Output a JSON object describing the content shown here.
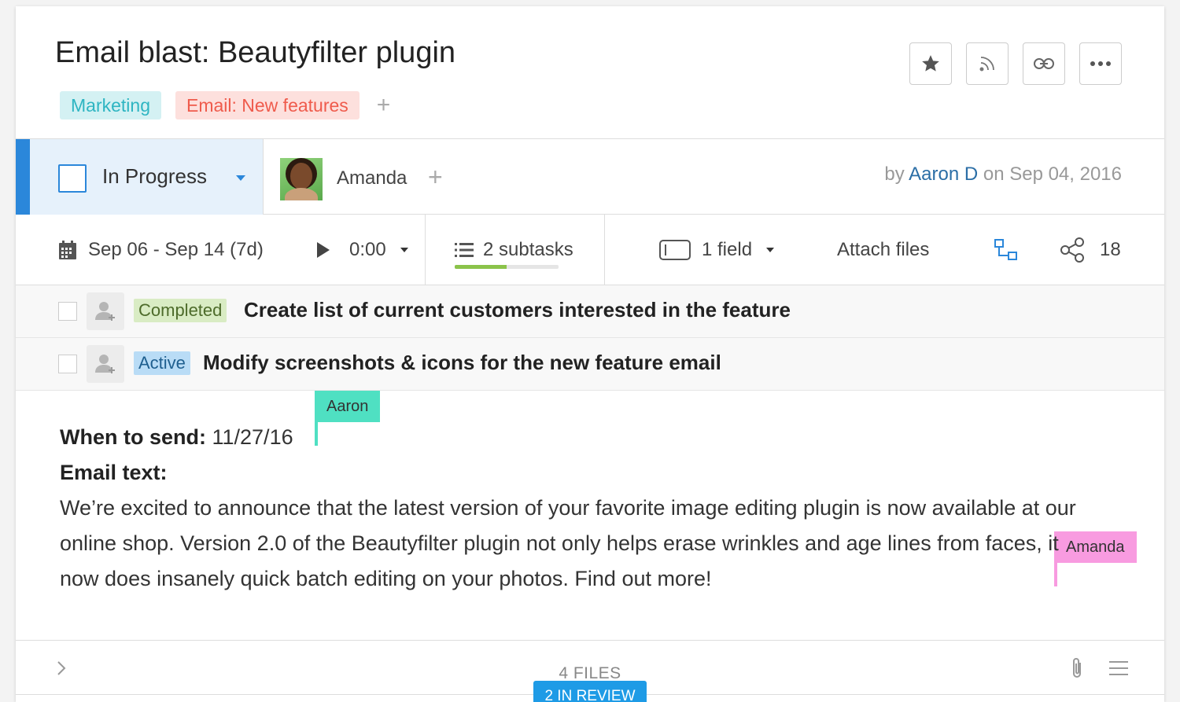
{
  "task": {
    "title": "Email blast: Beautyfilter plugin",
    "tags": [
      {
        "label": "Marketing",
        "color": "#2eb5c2",
        "bg": "#d4f1f3"
      },
      {
        "label": "Email: New features",
        "color": "#ef5b4c",
        "bg": "#fde0dd"
      }
    ],
    "tag_add": "+"
  },
  "header_buttons": [
    "star-icon",
    "rss-icon",
    "link-icon",
    "more-icon"
  ],
  "status": {
    "label": "In Progress",
    "color": "#2b87da"
  },
  "assignee": {
    "name": "Amanda",
    "add": "+"
  },
  "byline": {
    "prefix": "by",
    "author": "Aaron D",
    "date_text": "on Sep 04, 2016"
  },
  "meta": {
    "dates": "Sep 06 - Sep 14 (7d)",
    "timer": "0:00",
    "subtasks": "2 subtasks",
    "subtasks_progress": 0.5,
    "fields": "1 field",
    "attach": "Attach files",
    "shares": "18"
  },
  "subtasks": [
    {
      "status": "Completed",
      "title": "Create list of current customers interested in the feature"
    },
    {
      "status": "Active",
      "title": "Modify screenshots & icons for the new feature email"
    }
  ],
  "content": {
    "when_label": "When to send:",
    "when_value": "11/27/16",
    "email_label": "Email text:",
    "email_body": "We’re excited to announce that the latest version of your favorite image editing plugin is now available at our online shop. Version 2.0 of the Beautyfilter plugin not only helps erase wrinkles and age lines from faces, it now does insanely quick batch editing on your photos. Find out more!"
  },
  "collaborators": [
    {
      "name": "Aaron",
      "color": "#4fe0c2"
    },
    {
      "name": "Amanda",
      "color": "#f89be0"
    }
  ],
  "footer": {
    "files": "4 FILES",
    "review": "2 IN REVIEW"
  }
}
